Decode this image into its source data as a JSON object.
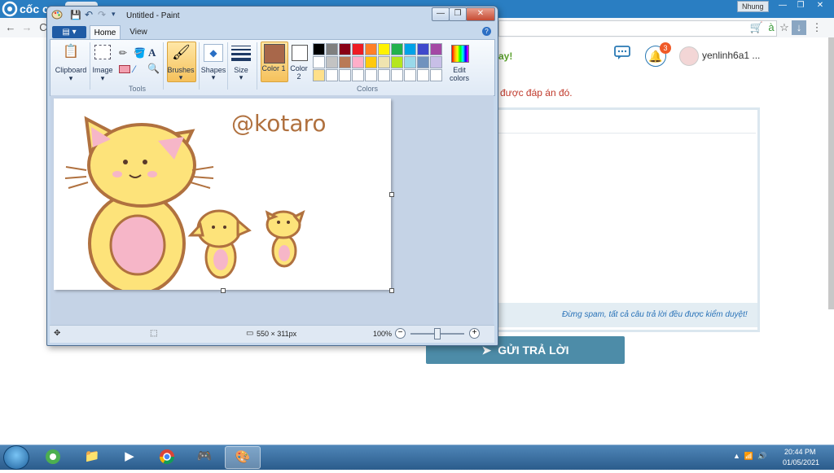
{
  "browser": {
    "brand": "cốc c",
    "profile": "Nhung",
    "window_controls": [
      "—",
      "❐",
      "✕"
    ],
    "toolbar_icons": [
      "back-icon",
      "forward-icon",
      "reload-icon",
      "cart-icon",
      "translate-icon",
      "star-icon",
      "download-icon",
      "menu-icon"
    ]
  },
  "webpage": {
    "green_text": "ay!",
    "answer_text": "được đáp án đó.",
    "spam_notice": "Đừng spam, tất cả câu trả lời đều được kiểm duyệt!",
    "submit_label": "GỬI TRẢ LỜI",
    "notification_count": "3",
    "username": "yenlinh6a1 ..."
  },
  "paint": {
    "title": "Untitled - Paint",
    "file_tab": "▾",
    "tabs": [
      "Home",
      "View"
    ],
    "groups": {
      "clipboard": "Clipboard",
      "image": "Image",
      "tools": "Tools",
      "brushes": "Brushes",
      "shapes": "Shapes",
      "size": "Size",
      "color1": "Color 1",
      "color2": "Color 2",
      "colors": "Colors",
      "edit_colors": "Edit colors"
    },
    "color1": "#a8674a",
    "color2": "#ffffff",
    "palette_row1": [
      "#000000",
      "#7f7f7f",
      "#880015",
      "#ed1c24",
      "#ff7f27",
      "#fff200",
      "#22b14c",
      "#00a2e8",
      "#3f48cc",
      "#a349a4"
    ],
    "palette_row2": [
      "#ffffff",
      "#c3c3c3",
      "#b97a57",
      "#ffaec9",
      "#ffc90e",
      "#efe4b0",
      "#b5e61d",
      "#99d9ea",
      "#7092be",
      "#c8bfe7"
    ],
    "palette_row3": [
      "#ffe08a",
      "#ffffff",
      "#ffffff",
      "#ffffff",
      "#ffffff",
      "#ffffff",
      "#ffffff",
      "#ffffff",
      "#ffffff",
      "#ffffff"
    ],
    "canvas_signature": "@kotaro",
    "dimensions": "550 × 311px",
    "zoom": "100%"
  },
  "taskbar": {
    "time": "20:44 PM",
    "date": "01/05/2021"
  }
}
